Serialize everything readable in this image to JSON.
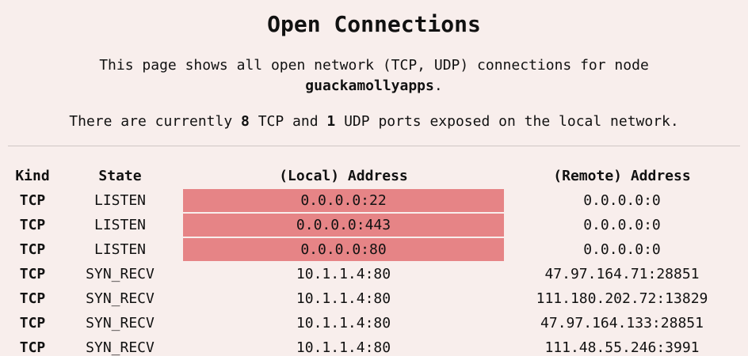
{
  "title": "Open Connections",
  "intro": {
    "text": "This page shows all open network (TCP, UDP) connections for node",
    "node": "guackamollyapps",
    "suffix": "."
  },
  "summary": {
    "prefix": "There are currently",
    "tcp_count": "8",
    "middle": "TCP and",
    "udp_count": "1",
    "suffix": "UDP ports exposed on the local network."
  },
  "table": {
    "headers": {
      "kind": "Kind",
      "state": "State",
      "local": "(Local) Address",
      "remote": "(Remote) Address"
    },
    "highlight_color": "#e68486",
    "rows": [
      {
        "kind": "TCP",
        "state": "LISTEN",
        "local": "0.0.0.0:22",
        "remote": "0.0.0.0:0",
        "highlighted": true
      },
      {
        "kind": "TCP",
        "state": "LISTEN",
        "local": "0.0.0.0:443",
        "remote": "0.0.0.0:0",
        "highlighted": true
      },
      {
        "kind": "TCP",
        "state": "LISTEN",
        "local": "0.0.0.0:80",
        "remote": "0.0.0.0:0",
        "highlighted": true
      },
      {
        "kind": "TCP",
        "state": "SYN_RECV",
        "local": "10.1.1.4:80",
        "remote": "47.97.164.71:28851",
        "highlighted": false
      },
      {
        "kind": "TCP",
        "state": "SYN_RECV",
        "local": "10.1.1.4:80",
        "remote": "111.180.202.72:13829",
        "highlighted": false
      },
      {
        "kind": "TCP",
        "state": "SYN_RECV",
        "local": "10.1.1.4:80",
        "remote": "47.97.164.133:28851",
        "highlighted": false
      },
      {
        "kind": "TCP",
        "state": "SYN_RECV",
        "local": "10.1.1.4:80",
        "remote": "111.48.55.246:3991",
        "highlighted": false
      }
    ]
  }
}
